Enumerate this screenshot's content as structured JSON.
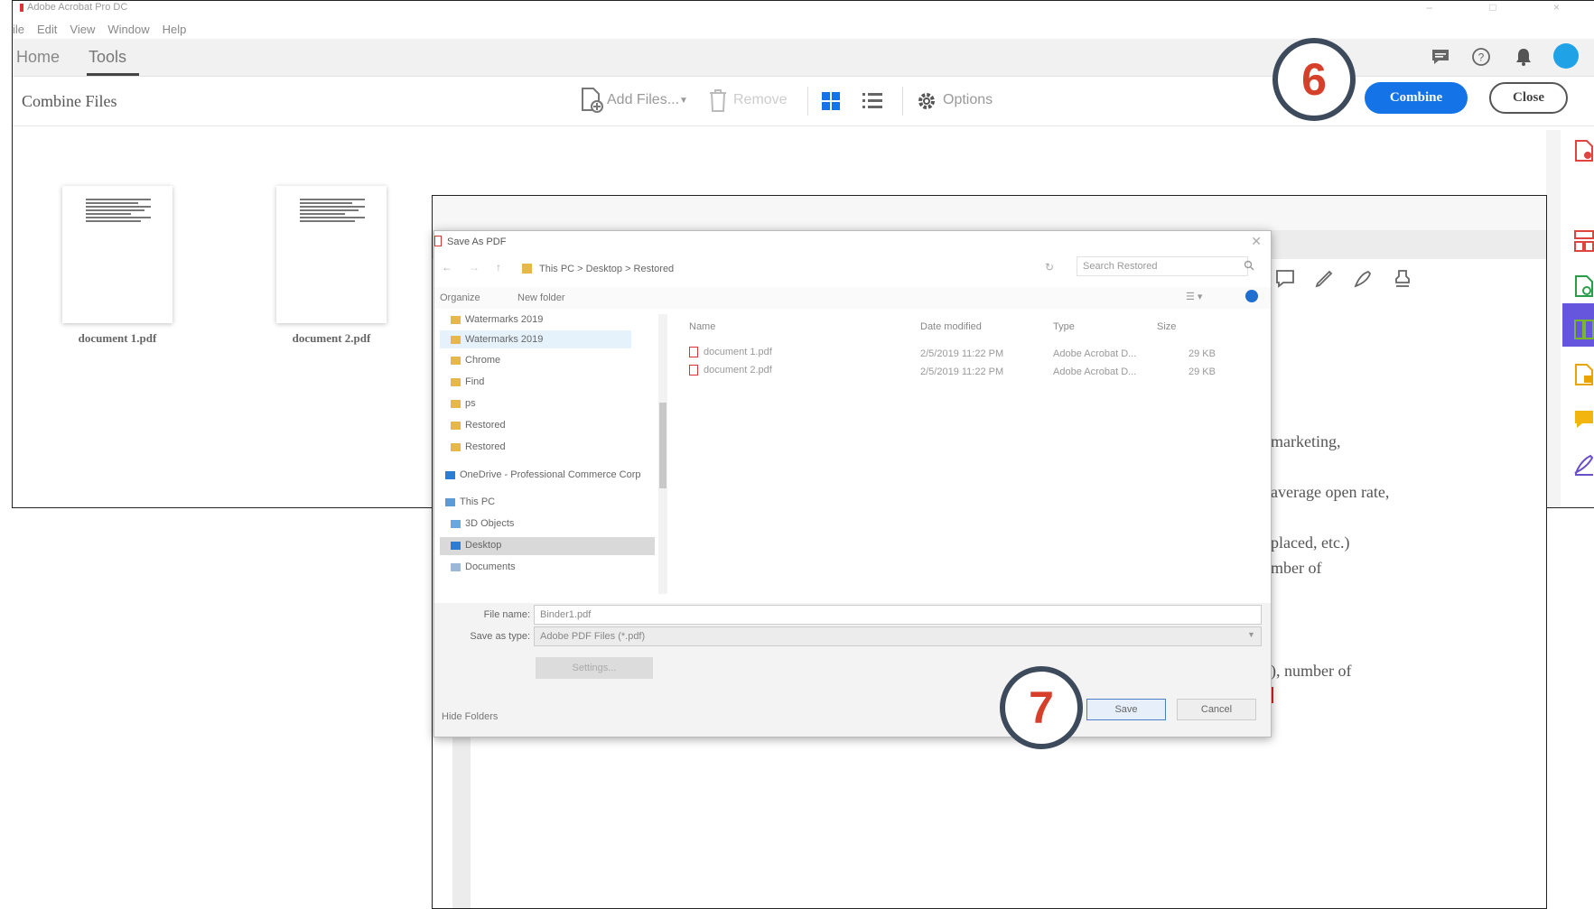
{
  "acrobat": {
    "title": "Adobe Acrobat Pro DC",
    "menu": [
      "ile",
      "Edit",
      "View",
      "Window",
      "Help"
    ],
    "tabs": {
      "home": "Home",
      "tools": "Tools"
    },
    "toolbar": {
      "title": "Combine Files",
      "add_files": "Add Files...",
      "remove": "Remove",
      "options": "Options",
      "combine": "Combine",
      "close": "Close"
    },
    "files": [
      "document 1.pdf",
      "document 2.pdf"
    ]
  },
  "document_window": {
    "snippets": [
      "marketing,",
      "average open rate,",
      "placed, etc.)",
      "mber of",
      "), number of"
    ]
  },
  "dialog": {
    "title": "Save As PDF",
    "address": "This PC  >  Desktop  >  Restored",
    "search_placeholder": "Search Restored",
    "cmd_organize": "Organize",
    "cmd_new_folder": "New folder",
    "nav_items": [
      "Watermarks 2019",
      "Watermarks 2019",
      "Chrome",
      "Find",
      "ps",
      "Restored",
      "Restored",
      "OneDrive - Professional Commerce Corp",
      "This PC",
      "3D Objects",
      "Desktop",
      "Documents"
    ],
    "columns": {
      "name": "Name",
      "date": "Date modified",
      "type": "Type",
      "size": "Size"
    },
    "files": [
      {
        "name": "document 1.pdf",
        "date": "2/5/2019 11:22 PM",
        "type": "Adobe Acrobat D...",
        "size": "29 KB"
      },
      {
        "name": "document 2.pdf",
        "date": "2/5/2019 11:22 PM",
        "type": "Adobe Acrobat D...",
        "size": "29 KB"
      }
    ],
    "filename_label": "File name:",
    "filename_value": "Binder1.pdf",
    "savetype_label": "Save as type:",
    "savetype_value": "Adobe PDF Files (*.pdf)",
    "settings_button": "Settings...",
    "save": "Save",
    "cancel": "Cancel",
    "hide_folders": "Hide Folders"
  },
  "callouts": {
    "step6": "6",
    "step7": "7"
  },
  "colors": {
    "accent": "#1473e6",
    "callout_border": "#3d4a5c",
    "callout_text": "#d6402b",
    "rail_selected": "#6655dd"
  }
}
